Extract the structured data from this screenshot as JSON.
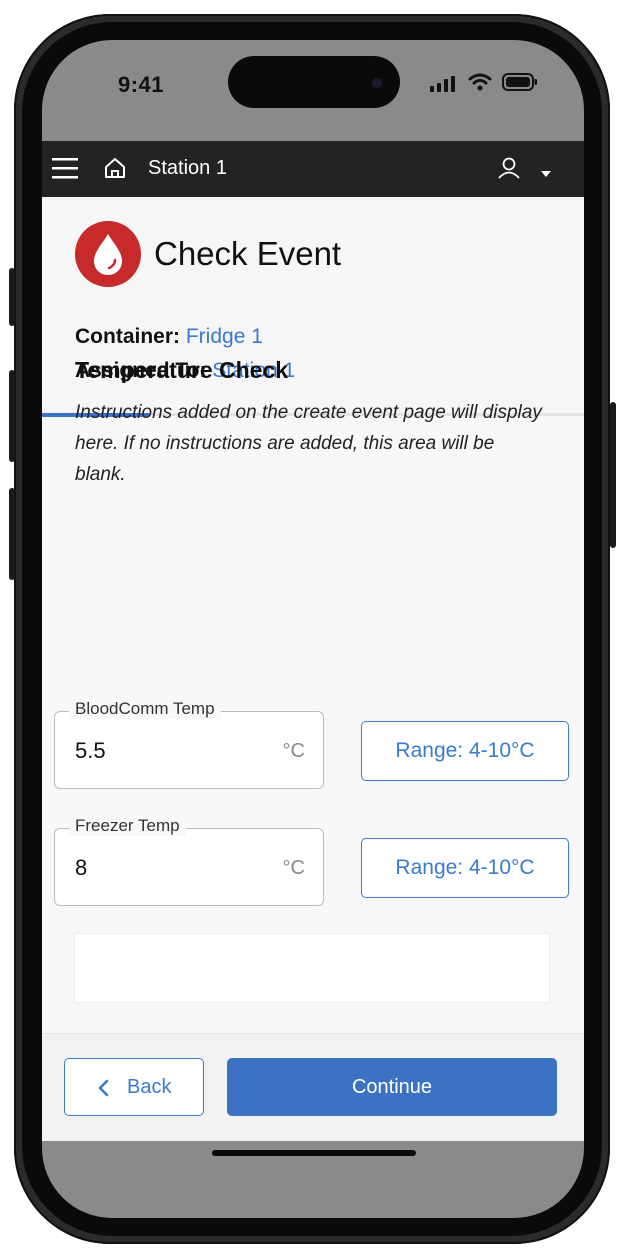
{
  "status_bar": {
    "time": "9:41"
  },
  "app_bar": {
    "station": "Station 1",
    "menu_icon": "hamburger-menu-icon",
    "home_icon": "home-icon",
    "user_icon": "user-icon",
    "dropdown_icon": "caret-down-icon"
  },
  "event": {
    "title": "Check Event",
    "logo_icon": "blood-drop-icon",
    "container_label": "Container:",
    "container_value": "Fridge 1",
    "assigned_label": "Assigned To:",
    "assigned_value": "Station 1"
  },
  "check": {
    "title": "Temperature Check",
    "instructions": "Instructions added on the create event page will display here. If no instructions are added, this area will be blank.",
    "fields": [
      {
        "label": "BloodComm Temp",
        "value": "5.5",
        "unit": "°C",
        "range": "Range: 4-10°C"
      },
      {
        "label": "Freezer Temp",
        "value": "8",
        "unit": "°C",
        "range": "Range: 4-10°C"
      }
    ]
  },
  "footer": {
    "back_label": "Back",
    "continue_label": "Continue"
  },
  "colors": {
    "accent": "#3a7ad0",
    "brand_red": "#c72a2a",
    "app_bar": "#232323"
  }
}
